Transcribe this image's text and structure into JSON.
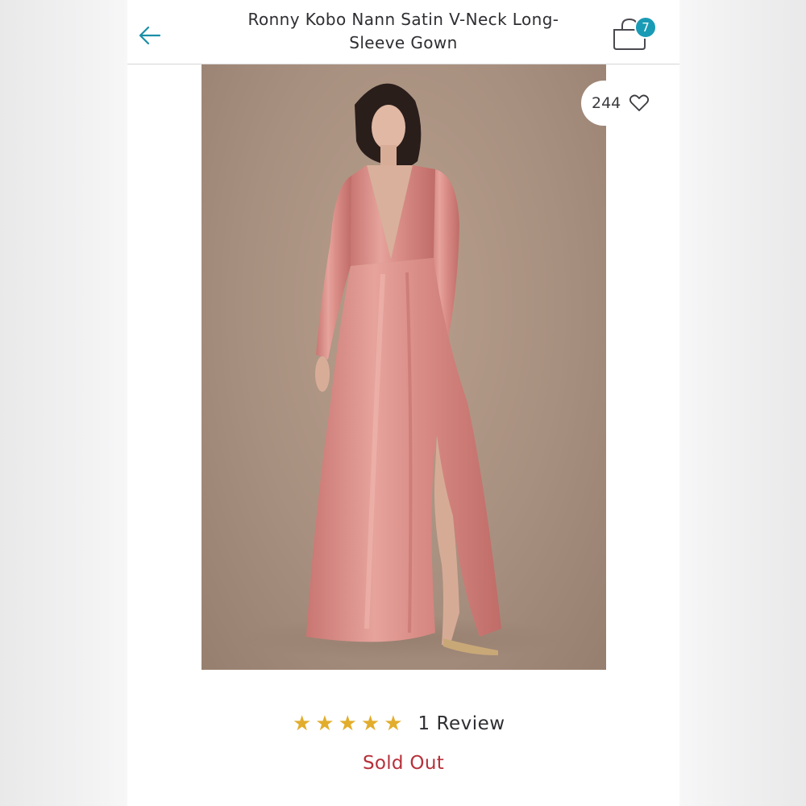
{
  "header": {
    "title_line1": "Ronny Kobo Nann Satin V-Neck Long-",
    "title_line2": "Sleeve Gown",
    "back_icon": "arrow-left-icon",
    "bag_icon": "shopping-bag-icon",
    "bag_count": "7"
  },
  "product": {
    "likes": "244",
    "like_icon": "heart-outline-icon",
    "rating": 5,
    "rating_max": 5,
    "rating_stars": "★★★★★",
    "review_label": "1 Review",
    "status": "Sold Out"
  },
  "colors": {
    "accent": "#1a9bb5",
    "star": "#e2ad2c",
    "sold_out": "#b7303a",
    "dress": "#d98b86",
    "backdrop": "#a89080"
  }
}
